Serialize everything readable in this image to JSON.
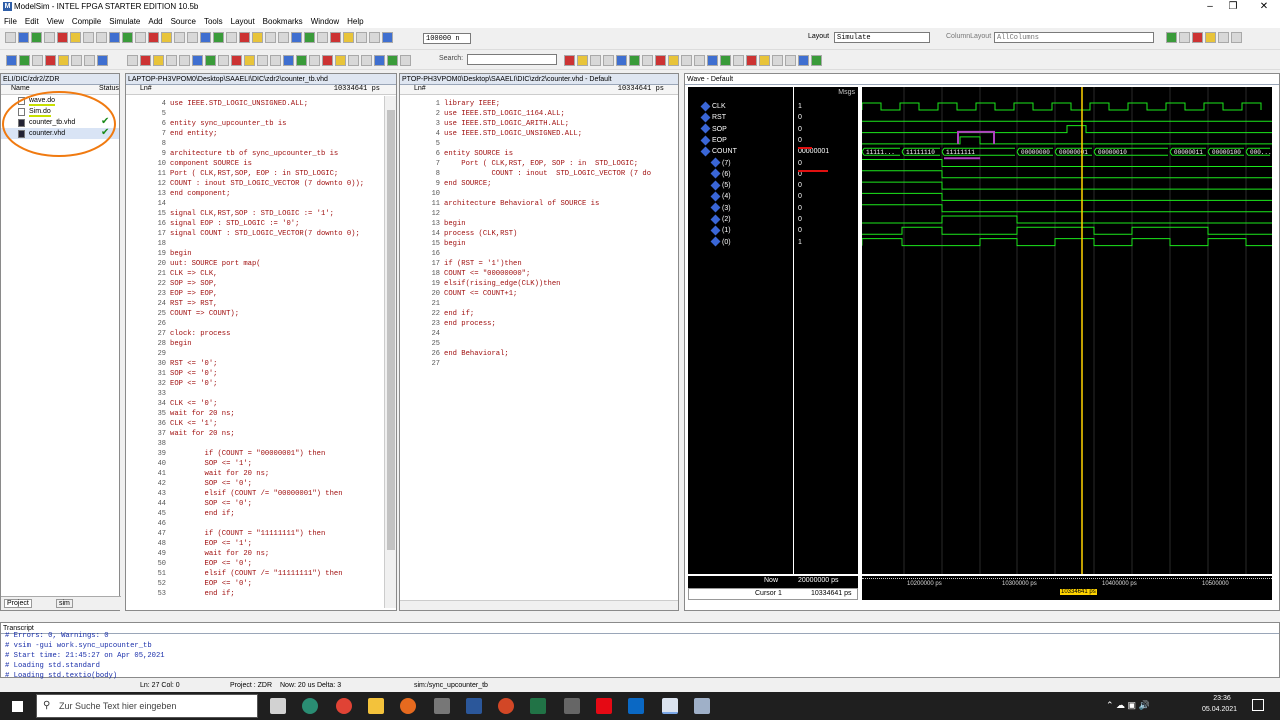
{
  "window": {
    "title": "ModelSim - INTEL FPGA STARTER EDITION 10.5b"
  },
  "menu": [
    "File",
    "Edit",
    "View",
    "Compile",
    "Simulate",
    "Add",
    "Source",
    "Tools",
    "Layout",
    "Bookmarks",
    "Window",
    "Help"
  ],
  "toolbar": {
    "runtime": "100000 n",
    "search_placeholder": "Search:",
    "layout_label": "Layout",
    "layout_value": "Simulate",
    "column_layout_label": "ColumnLayout",
    "column_layout_value": "AllColumns"
  },
  "project": {
    "title": "ELI/DIC/zdr2/ZDR",
    "col_name": "Name",
    "col_status": "Status",
    "files": [
      "wave.do",
      "Sim.do",
      "counter_tb.vhd",
      "counter.vhd"
    ],
    "tabs": [
      "Project",
      "sim"
    ]
  },
  "editor1": {
    "title": "LAPTOP-PH3VPOM0\\Desktop\\SAAELI\\DIC\\zdr2\\counter_tb.vhd",
    "ln_label": "Ln#",
    "time": "10334641 ps",
    "lines": [
      [
        "4",
        "use IEEE.STD_LOGIC_UNSIGNED.ALL;"
      ],
      [
        "5",
        ""
      ],
      [
        "6",
        "entity sync_upcounter_tb is"
      ],
      [
        "7",
        "end entity;"
      ],
      [
        "8",
        ""
      ],
      [
        "9",
        "architecture tb of sync_upcounter_tb is"
      ],
      [
        "10",
        "component SOURCE is"
      ],
      [
        "11",
        "Port ( CLK,RST,SOP, EOP : in STD_LOGIC;"
      ],
      [
        "12",
        "COUNT : inout STD_LOGIC_VECTOR (7 downto 0));"
      ],
      [
        "13",
        "end component;"
      ],
      [
        "14",
        ""
      ],
      [
        "15",
        "signal CLK,RST,SOP : STD_LOGIC := '1';"
      ],
      [
        "16",
        "signal EOP : STD_LOGIC := '0';"
      ],
      [
        "17",
        "signal COUNT : STD_LOGIC_VECTOR(7 downto 0);"
      ],
      [
        "18",
        ""
      ],
      [
        "19",
        "begin"
      ],
      [
        "20",
        "uut: SOURCE port map("
      ],
      [
        "21",
        "CLK => CLK,"
      ],
      [
        "22",
        "SOP => SOP,"
      ],
      [
        "23",
        "EOP => EOP,"
      ],
      [
        "24",
        "RST => RST,"
      ],
      [
        "25",
        "COUNT => COUNT);"
      ],
      [
        "26",
        ""
      ],
      [
        "27",
        "clock: process"
      ],
      [
        "28",
        "begin"
      ],
      [
        "29",
        ""
      ],
      [
        "30",
        "RST <= '0';"
      ],
      [
        "31",
        "SOP <= '0';"
      ],
      [
        "32",
        "EOP <= '0';"
      ],
      [
        "33",
        ""
      ],
      [
        "34",
        "CLK <= '0';"
      ],
      [
        "35",
        "wait for 20 ns;"
      ],
      [
        "36",
        "CLK <= '1';"
      ],
      [
        "37",
        "wait for 20 ns;"
      ],
      [
        "38",
        ""
      ],
      [
        "39",
        "        if (COUNT = \"00000001\") then"
      ],
      [
        "40",
        "        SOP <= '1';"
      ],
      [
        "41",
        "        wait for 20 ns;"
      ],
      [
        "42",
        "        SOP <= '0';"
      ],
      [
        "43",
        "        elsif (COUNT /= \"00000001\") then"
      ],
      [
        "44",
        "        SOP <= '0';"
      ],
      [
        "45",
        "        end if;"
      ],
      [
        "46",
        ""
      ],
      [
        "47",
        "        if (COUNT = \"11111111\") then"
      ],
      [
        "48",
        "        EOP <= '1';"
      ],
      [
        "49",
        "        wait for 20 ns;"
      ],
      [
        "50",
        "        EOP <= '0';"
      ],
      [
        "51",
        "        elsif (COUNT /= \"11111111\") then"
      ],
      [
        "52",
        "        EOP <= '0';"
      ],
      [
        "53",
        "        end if;"
      ],
      [
        "54",
        ""
      ]
    ]
  },
  "editor2": {
    "title": "PTOP-PH3VPOM0\\Desktop\\SAAELI\\DIC\\zdr2\\counter.vhd - Default",
    "ln_label": "Ln#",
    "time": "10334641 ps",
    "lines": [
      [
        "1",
        "library IEEE;"
      ],
      [
        "2",
        "use IEEE.STD_LOGIC_1164.ALL;"
      ],
      [
        "3",
        "use IEEE.STD_LOGIC_ARITH.ALL;"
      ],
      [
        "4",
        "use IEEE.STD_LOGIC_UNSIGNED.ALL;"
      ],
      [
        "5",
        ""
      ],
      [
        "6",
        "entity SOURCE is"
      ],
      [
        "7",
        "    Port ( CLK,RST, EOP, SOP : in  STD_LOGIC;"
      ],
      [
        "8",
        "           COUNT : inout  STD_LOGIC_VECTOR (7 do"
      ],
      [
        "9",
        "end SOURCE;"
      ],
      [
        "10",
        ""
      ],
      [
        "11",
        "architecture Behavioral of SOURCE is"
      ],
      [
        "12",
        ""
      ],
      [
        "13",
        "begin"
      ],
      [
        "14",
        "process (CLK,RST)"
      ],
      [
        "15",
        "begin"
      ],
      [
        "16",
        ""
      ],
      [
        "17",
        "if (RST = '1')then"
      ],
      [
        "18",
        "COUNT <= \"00000000\";"
      ],
      [
        "19",
        "elsif(rising_edge(CLK))then"
      ],
      [
        "20",
        "COUNT <= COUNT+1;"
      ],
      [
        "21",
        ""
      ],
      [
        "22",
        "end if;"
      ],
      [
        "23",
        "end process;"
      ],
      [
        "24",
        ""
      ],
      [
        "25",
        ""
      ],
      [
        "26",
        "end Behavioral;"
      ],
      [
        "27",
        ""
      ]
    ]
  },
  "wave": {
    "title": "Wave - Default",
    "msgs_label": "Msgs",
    "signals": [
      [
        "CLK",
        "1"
      ],
      [
        "RST",
        "0"
      ],
      [
        "SOP",
        "0"
      ],
      [
        "EOP",
        "0"
      ],
      [
        "COUNT",
        "00000001"
      ],
      [
        "(7)",
        "0"
      ],
      [
        "(6)",
        "0"
      ],
      [
        "(5)",
        "0"
      ],
      [
        "(4)",
        "0"
      ],
      [
        "(3)",
        "0"
      ],
      [
        "(2)",
        "0"
      ],
      [
        "(1)",
        "0"
      ],
      [
        "(0)",
        "1"
      ]
    ],
    "bus_values": [
      "11111...",
      "11111110",
      "11111111",
      "00000000",
      "00000001",
      "00000010",
      "00000011",
      "00000100",
      "000..."
    ],
    "now_label": "Now",
    "now_value": "20000000 ps",
    "cursor_label": "Cursor 1",
    "cursor_value": "10334641 ps",
    "time_ticks": [
      "10200000 ps",
      "10300000 ps",
      "10400000 ps",
      "10500000"
    ],
    "cursor_tag": "10334641 ps"
  },
  "transcript": {
    "title": "Transcript",
    "lines": [
      "# Errors: 0, Warnings: 0",
      "# vsim -gui work.sync_upcounter_tb",
      "# Start time: 21:45:27 on Apr 05,2021",
      "# Loading std.standard",
      "# Loading std.textio(body)"
    ]
  },
  "statusbar": {
    "ln": "Ln:   27 Col:  0",
    "project": "Project : ZDR",
    "now": "Now: 20 us  Delta: 3",
    "context": "sim:/sync_upcounter_tb"
  },
  "taskbar": {
    "search": "Zur Suche Text hier eingeben",
    "time": "23:36",
    "date": "05.04.2021"
  }
}
